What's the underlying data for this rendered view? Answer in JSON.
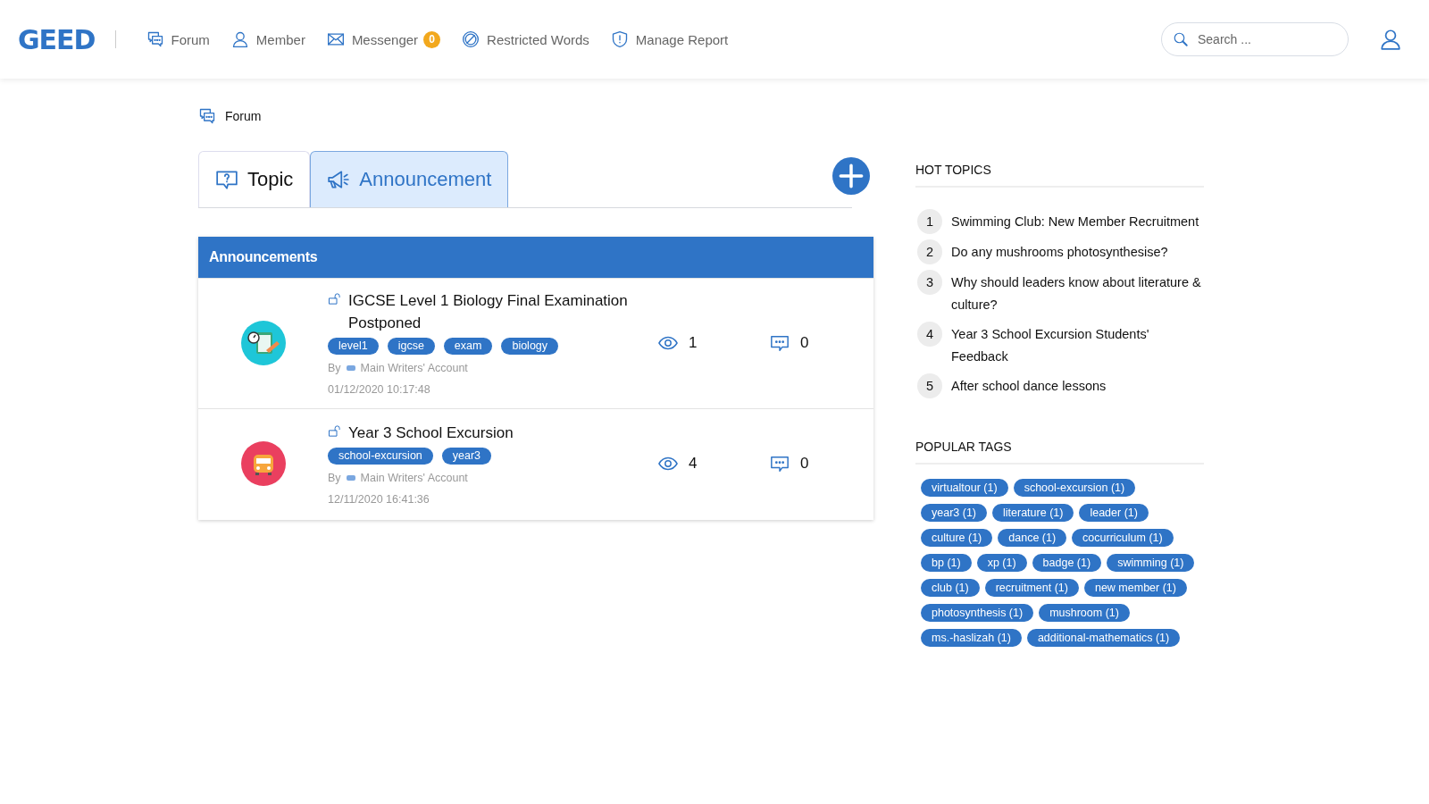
{
  "header": {
    "logo": "GEED",
    "nav": [
      {
        "kind": "forum",
        "label": "Forum"
      },
      {
        "kind": "member",
        "label": "Member"
      },
      {
        "kind": "messenger",
        "label": "Messenger",
        "badge": "0"
      },
      {
        "kind": "restricted",
        "label": "Restricted Words"
      },
      {
        "kind": "report",
        "label": "Manage Report"
      }
    ],
    "search": {
      "placeholder": "Search ..."
    }
  },
  "breadcrumb": "Forum",
  "tabs": [
    {
      "kind": "topic",
      "label": "Topic",
      "selected": false
    },
    {
      "kind": "announcement",
      "label": "Announcement",
      "selected": true
    }
  ],
  "panel": {
    "title": "Announcements",
    "items": [
      {
        "kind": "clipboard",
        "title": "IGCSE Level 1 Biology Final Examination Postponed",
        "tags": [
          "level1",
          "igcse",
          "exam",
          "biology"
        ],
        "by": "By",
        "author": "Main Writers' Account",
        "date": "01/12/2020 10:17:48",
        "views": "1",
        "comments": "0"
      },
      {
        "kind": "bus",
        "title": "Year 3 School Excursion",
        "tags": [
          "school-excursion",
          "year3"
        ],
        "by": "By",
        "author": "Main Writers' Account",
        "date": "12/11/2020 16:41:36",
        "views": "4",
        "comments": "0"
      }
    ]
  },
  "hot_topics": {
    "title": "HOT TOPICS",
    "items": [
      {
        "rank": "1",
        "text": "Swimming Club: New Member Recruitment"
      },
      {
        "rank": "2",
        "text": "Do any mushrooms photosynthesise?"
      },
      {
        "rank": "3",
        "text": "Why should leaders know about literature & culture?"
      },
      {
        "rank": "4",
        "text": "Year 3 School Excursion Students' Feedback"
      },
      {
        "rank": "5",
        "text": "After school dance lessons"
      }
    ]
  },
  "popular_tags": {
    "title": "POPULAR TAGS",
    "items": [
      "virtualtour (1)",
      "school-excursion (1)",
      "year3 (1)",
      "literature (1)",
      "leader (1)",
      "culture (1)",
      "dance (1)",
      "cocurriculum (1)",
      "bp (1)",
      "xp (1)",
      "badge (1)",
      "swimming (1)",
      "club (1)",
      "recruitment (1)",
      "new member (1)",
      "photosynthesis (1)",
      "mushroom (1)",
      "ms.-haslizah (1)",
      "additional-mathematics (1)"
    ]
  }
}
